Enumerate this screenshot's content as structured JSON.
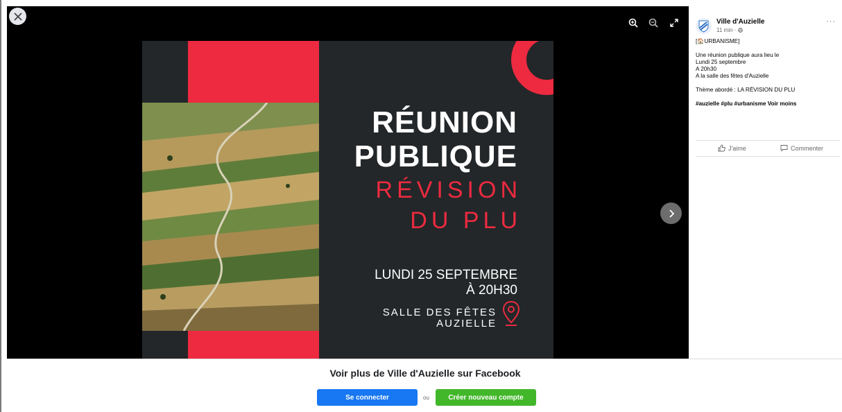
{
  "viewer": {
    "icons": {
      "close": "close-icon",
      "zoom_in": "zoom-in-icon",
      "zoom_out": "zoom-out-icon",
      "fullscreen": "expand-icon",
      "next": "chevron-right-icon"
    }
  },
  "poster": {
    "title_line1": "RÉUNION",
    "title_line2": "PUBLIQUE",
    "subtitle_line1": "RÉVISION",
    "subtitle_line2": "DU PLU",
    "date_line1": "LUNDI 25 SEPTEMBRE",
    "date_line2": "À 20H30",
    "place_line1": "SALLE DES FÊTES",
    "place_line2": "AUZIELLE",
    "colors": {
      "red": "#ed2a40",
      "dark": "#232729"
    }
  },
  "post": {
    "page_name": "Ville d'Auzielle",
    "meta": "11 min · ",
    "category": "[🏠URBANISME]",
    "body": [
      "Une réunion publique aura lieu le",
      "Lundi 25 septembre",
      "A 20h30",
      "A la salle des fêtes d'Auzielle"
    ],
    "theme": "Thème abordé : LA RÉVISION DU PLU",
    "tags": "#auzielle #plu #urbanisme Voir moins",
    "more": "···",
    "like_label": "J'aime",
    "comment_label": "Commenter"
  },
  "banner": {
    "title": "Voir plus de Ville d'Auzielle sur Facebook",
    "login_label": "Se connecter",
    "or_label": "ou",
    "signup_label": "Créer nouveau compte",
    "colors": {
      "login": "#1877f2",
      "signup": "#42b72a"
    }
  }
}
